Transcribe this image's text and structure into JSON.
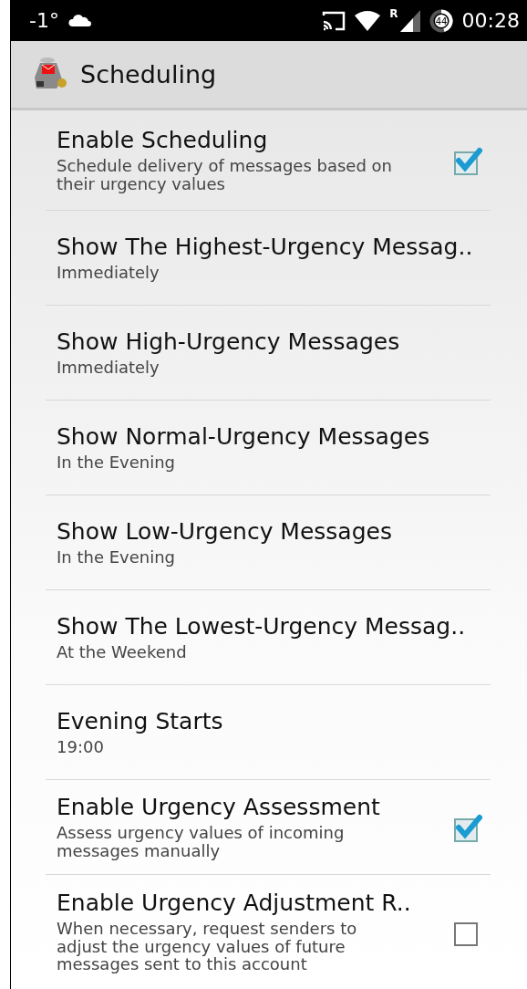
{
  "status_bar": {
    "temperature": "-1°",
    "signal_label": "R",
    "battery": "44",
    "time": "00:28"
  },
  "action_bar": {
    "title": "Scheduling"
  },
  "settings": [
    {
      "kind": "checkbox",
      "title": "Enable Scheduling",
      "summary": "Schedule delivery of messages based on their urgency values",
      "checked": true
    },
    {
      "kind": "choice",
      "title": "Show The Highest-Urgency Messag..",
      "summary": "Immediately"
    },
    {
      "kind": "choice",
      "title": "Show High-Urgency Messages",
      "summary": "Immediately"
    },
    {
      "kind": "choice",
      "title": "Show Normal-Urgency Messages",
      "summary": "In the Evening"
    },
    {
      "kind": "choice",
      "title": "Show Low-Urgency Messages",
      "summary": "In the Evening"
    },
    {
      "kind": "choice",
      "title": "Show The Lowest-Urgency Messag..",
      "summary": "At the Weekend"
    },
    {
      "kind": "choice",
      "title": "Evening Starts",
      "summary": "19:00"
    },
    {
      "kind": "checkbox",
      "title": "Enable Urgency Assessment",
      "summary": "Assess urgency values of incoming messages manually",
      "checked": true
    },
    {
      "kind": "checkbox",
      "title": "Enable Urgency Adjustment R..",
      "summary": "When necessary, request senders to adjust the urgency values of future messages sent to this account",
      "checked": false
    }
  ]
}
